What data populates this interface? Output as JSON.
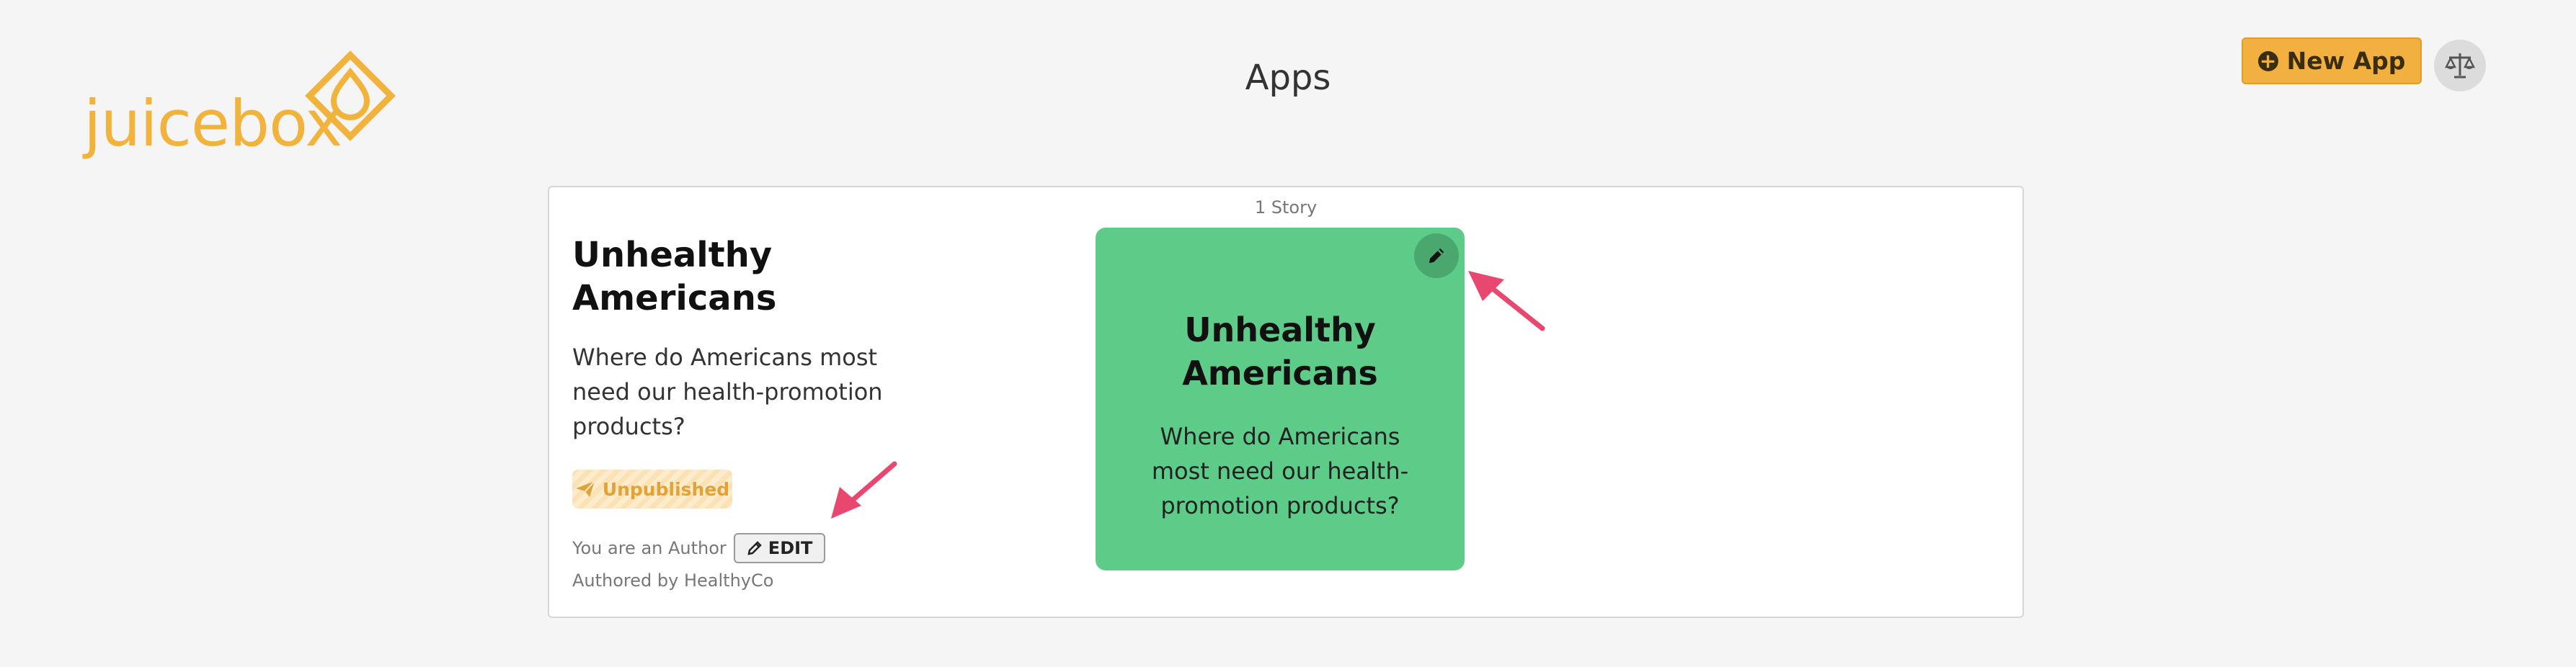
{
  "brand": {
    "logo_light": "juice",
    "logo_bold": "box",
    "color": "#f1b33c"
  },
  "header": {
    "title": "Apps",
    "new_app_label": "New App",
    "new_app_icon": "plus-circle-icon",
    "avatar_icon": "scales-icon"
  },
  "app": {
    "story_count": "1 Story",
    "title": "Unhealthy Americans",
    "description": "Where do Americans most need our health-promotion products?",
    "status": "Unpublished",
    "status_icon": "paper-plane-icon",
    "author_text": "You are an Author",
    "edit_label": "EDIT",
    "authored_by": "Authored by HealthyCo"
  },
  "story": {
    "title": "Unhealthy Americans",
    "description": "Where do Americans most need our health-promotion products?",
    "color": "#5ecc89"
  },
  "colors": {
    "accent": "#f1b040",
    "arrow": "#e8476f",
    "background": "#f5f5f5"
  }
}
